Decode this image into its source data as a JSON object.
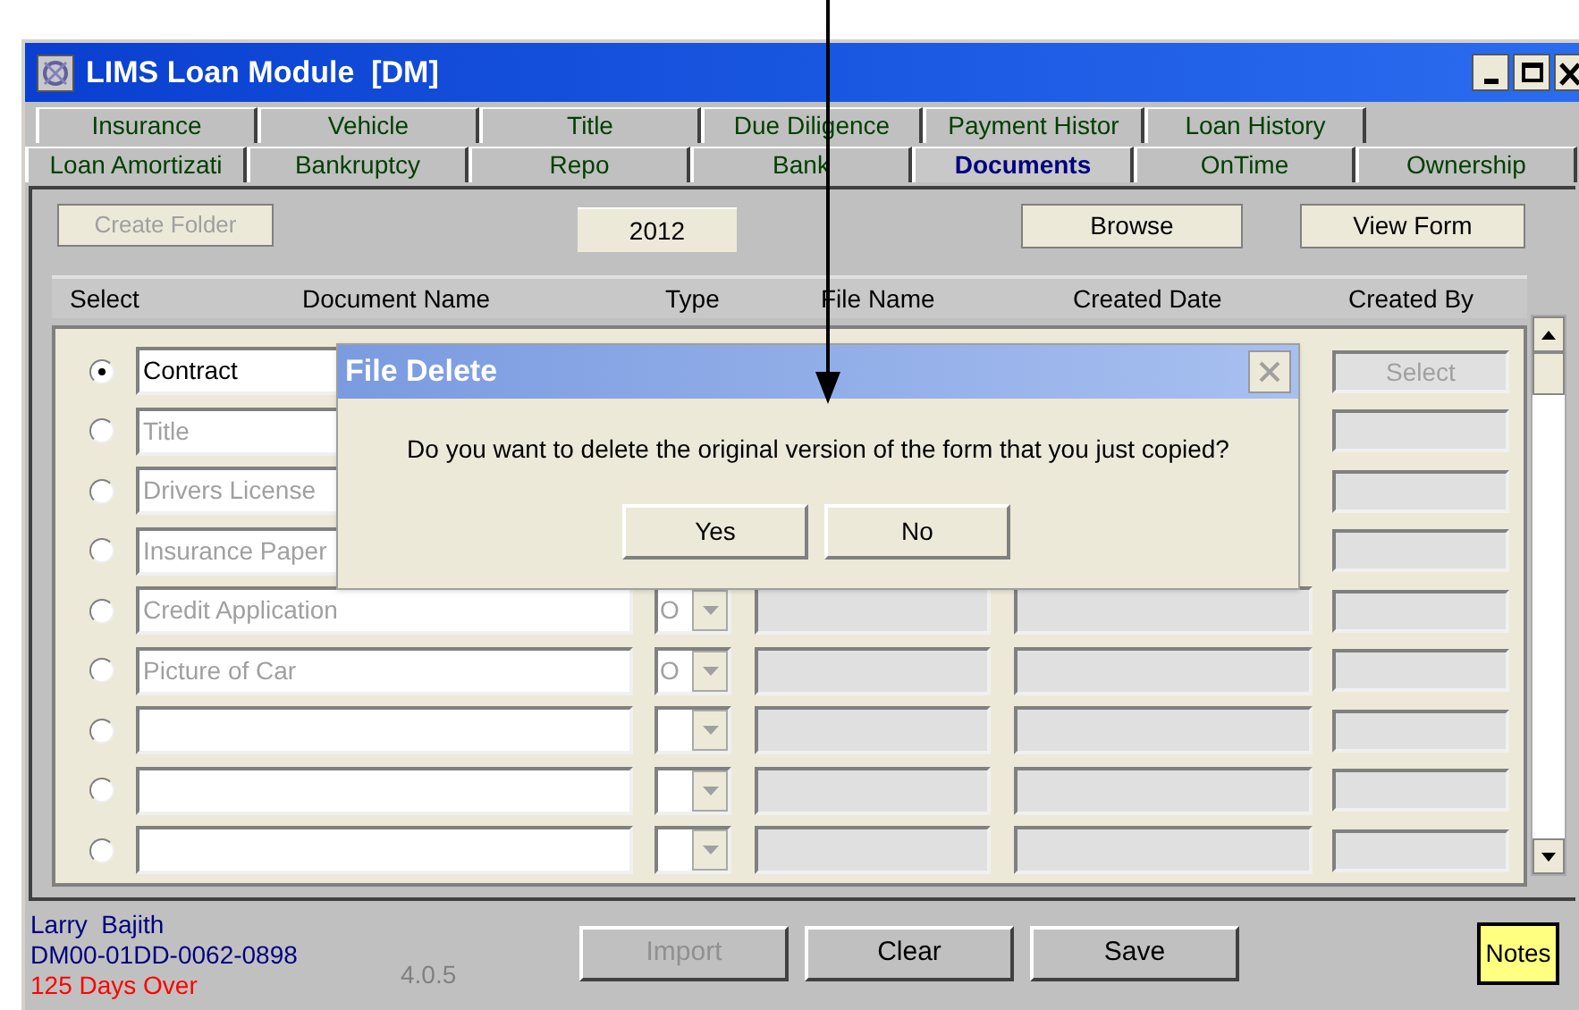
{
  "window": {
    "title": "LIMS Loan Module  [DM]"
  },
  "tab_rows": [
    [
      {
        "label": "Insurance",
        "selected": false
      },
      {
        "label": "Vehicle",
        "selected": false
      },
      {
        "label": "Title",
        "selected": false
      },
      {
        "label": "Due Diligence",
        "selected": false
      },
      {
        "label": "Payment Histor",
        "selected": false
      },
      {
        "label": "Loan History",
        "selected": false
      }
    ],
    [
      {
        "label": "Loan Amortizati",
        "selected": false
      },
      {
        "label": "Bankruptcy",
        "selected": false
      },
      {
        "label": "Repo",
        "selected": false
      },
      {
        "label": "Bank",
        "selected": false
      },
      {
        "label": "Documents",
        "selected": true
      },
      {
        "label": "OnTime",
        "selected": false
      },
      {
        "label": "Ownership",
        "selected": false
      }
    ]
  ],
  "toolbar": {
    "create_folder": {
      "label": "Create Folder",
      "disabled": true
    },
    "year": "2012",
    "browse": "Browse",
    "view_form": "View Form"
  },
  "table": {
    "columns": [
      "Select",
      "Document Name",
      "Type",
      "File Name",
      "Created Date",
      "Created By"
    ],
    "rows": [
      {
        "kind": "partly_hidden",
        "selected": true,
        "disabled": false,
        "document_name": "Contract",
        "created_by_button": "Select"
      },
      {
        "kind": "partly_hidden",
        "selected": false,
        "disabled": true,
        "document_name": "Title"
      },
      {
        "kind": "partly_hidden",
        "selected": false,
        "disabled": true,
        "document_name": "Drivers License"
      },
      {
        "kind": "partly_hidden",
        "selected": false,
        "disabled": true,
        "document_name": "Insurance Paper"
      },
      {
        "kind": "full",
        "selected": false,
        "disabled": true,
        "document_name": "Credit Application",
        "type": "O"
      },
      {
        "kind": "full",
        "selected": false,
        "disabled": true,
        "document_name": "Picture of Car",
        "type": "O"
      },
      {
        "kind": "full",
        "selected": false
      },
      {
        "kind": "full",
        "selected": false
      },
      {
        "kind": "full",
        "selected": false
      }
    ]
  },
  "status_bar": {
    "user": "Larry  Bajith",
    "loan_id": "DM00-01DD-0062-0898",
    "overdue": "125 Days Over",
    "version": "4.0.5"
  },
  "buttons": [
    {
      "label": "Import",
      "disabled": true
    },
    {
      "label": "Clear",
      "disabled": false
    },
    {
      "label": "Save",
      "disabled": false
    }
  ],
  "notes_button": "Notes",
  "dialog": {
    "title": "File Delete",
    "message": "Do you want to delete the original version of the form that you just copied?",
    "buttons": [
      "Yes",
      "No"
    ]
  }
}
